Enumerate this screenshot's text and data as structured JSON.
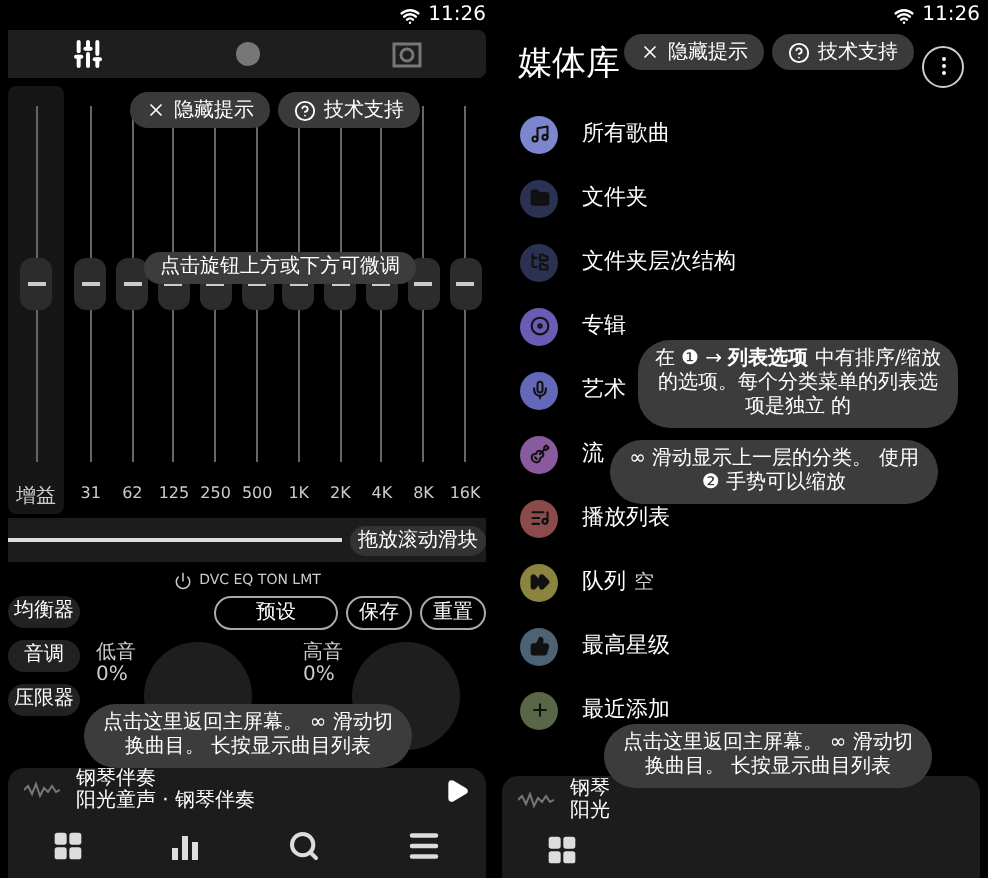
{
  "equalizer_screen": {
    "status_bar": {
      "time": "11:26"
    },
    "tabs": [
      {
        "kind": "sliders",
        "selected": true
      },
      {
        "kind": "knob",
        "selected": false
      },
      {
        "kind": "speaker",
        "selected": false
      }
    ],
    "hint_buttons": [
      {
        "kind": "close",
        "label": "隐藏提示"
      },
      {
        "kind": "help",
        "label": "技术支持"
      }
    ],
    "bands": [
      {
        "label": "增益",
        "level": 0.5
      },
      {
        "label": "31",
        "level": 0.5
      },
      {
        "label": "62",
        "level": 0.5
      },
      {
        "label": "125",
        "level": 0.5
      },
      {
        "label": "250",
        "level": 0.5
      },
      {
        "label": "500",
        "level": 0.5
      },
      {
        "label": "1K",
        "level": 0.5
      },
      {
        "label": "2K",
        "level": 0.5
      },
      {
        "label": "4K",
        "level": 0.5
      },
      {
        "label": "8K",
        "level": 0.5
      },
      {
        "label": "16K",
        "level": 0.5
      }
    ],
    "fine_tune_hint": "点击旋钮上方或下方可微调",
    "scroll_slider": {
      "label": "拖放滚动滑块",
      "level": 0.7
    },
    "effects_label": "DVC EQ TON LMT",
    "modules": [
      "均衡器",
      "音调",
      "压限器"
    ],
    "preset_buttons": [
      "预设",
      "保存",
      "重置"
    ],
    "knobs": [
      {
        "label": "低音",
        "reading": "0%"
      },
      {
        "label": "高音",
        "reading": "0%"
      }
    ],
    "player_hint": "点击这里返回主屏幕。 ∞ 滑动切换曲目。 长按显示曲目列表",
    "now_playing": {
      "title": "钢琴伴奏",
      "subtitle": "阳光童声 · 钢琴伴奏"
    }
  },
  "library_screen": {
    "status_bar": {
      "time": "11:26"
    },
    "title": "媒体库",
    "hint_buttons": [
      {
        "kind": "close",
        "label": "隐藏提示"
      },
      {
        "kind": "help",
        "label": "技术支持"
      }
    ],
    "items": [
      {
        "kind": "music",
        "label": "所有歌曲",
        "color": "#7b86cc"
      },
      {
        "kind": "folder",
        "label": "文件夹",
        "color": "#2b3150"
      },
      {
        "kind": "tree",
        "label": "文件夹层次结构",
        "color": "#2b3150"
      },
      {
        "kind": "album",
        "label": "专辑",
        "color": "#6a5cb4"
      },
      {
        "kind": "mic",
        "label": "艺术",
        "color": "#6468b8"
      },
      {
        "kind": "guitar",
        "label": "流",
        "color": "#8a5a9e"
      },
      {
        "kind": "playlist",
        "label": "播放列表",
        "color": "#8c4b4b"
      },
      {
        "kind": "queue",
        "label": "队列",
        "note": "空",
        "color": "#8a843e"
      },
      {
        "kind": "star",
        "label": "最高星级",
        "color": "#4d6374"
      },
      {
        "kind": "recent",
        "label": "最近添加",
        "color": "#5a6648"
      }
    ],
    "list_hint": "在 ❶ → **列表选项** 中有排序/缩放的选项。每个分类菜单的列表选项是独立 的",
    "swipe_hint": "∞ 滑动显示上一层的分类。 使用 ❷ 手势可以缩放",
    "player_hint": "点击这里返回主屏幕。 ∞ 滑动切换曲目。 长按显示曲目列表",
    "now_playing": {
      "title": "钢琴",
      "subtitle": "阳光"
    }
  }
}
